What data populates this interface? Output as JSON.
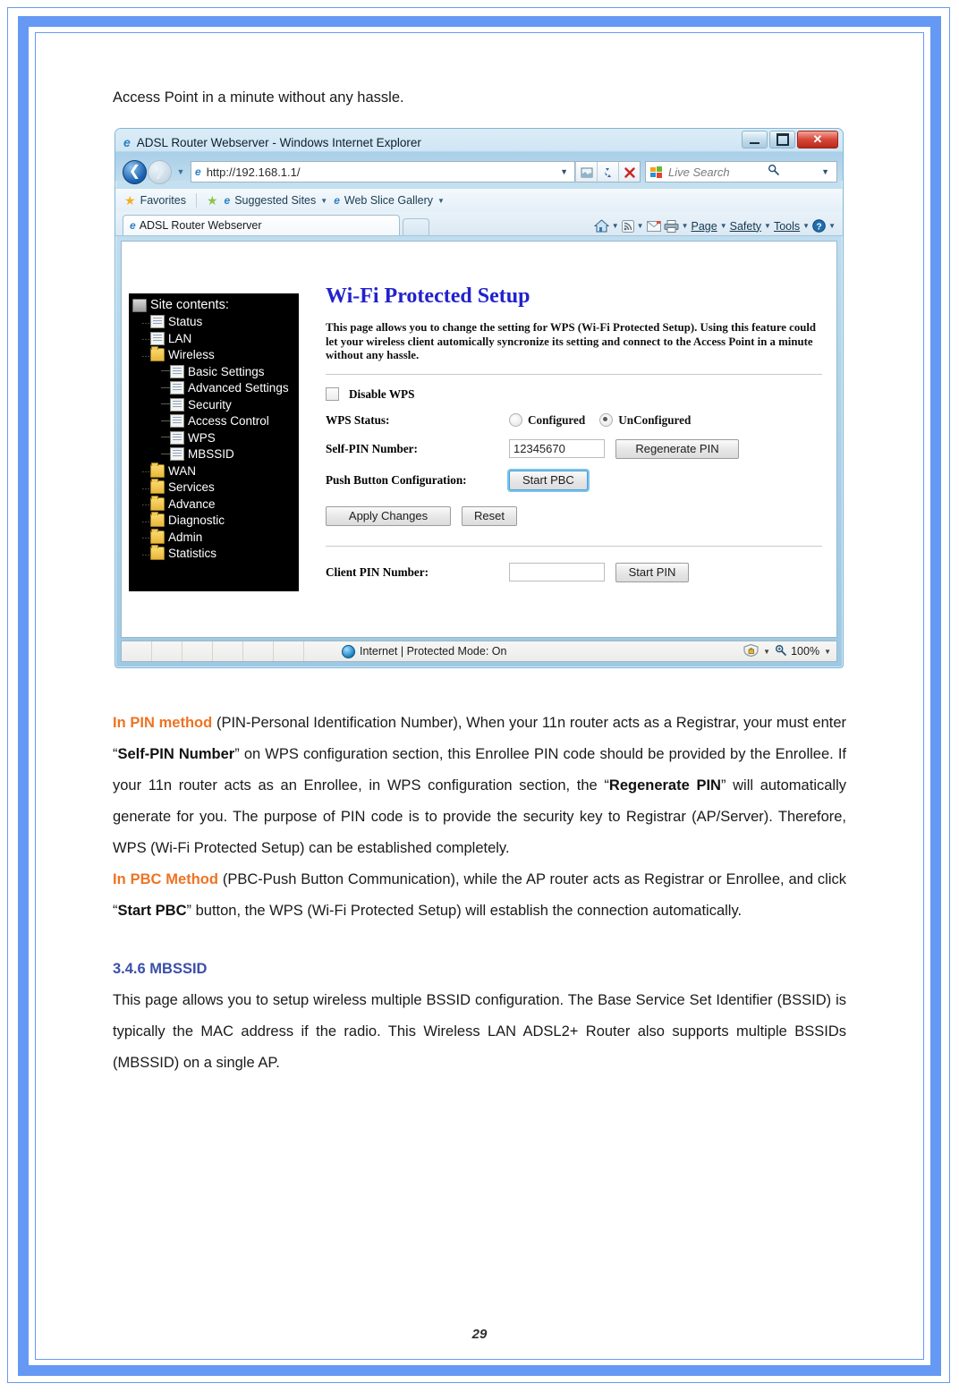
{
  "page": {
    "number": "29",
    "intro_line": "Access Point in a minute without any hassle.",
    "accent_orange": "#ee7322",
    "accent_blue": "#3b4fa8",
    "border_color": "#6699f3"
  },
  "paragraphs": {
    "pin_method": {
      "lead": "In PIN method",
      "t1": " (PIN-Personal Identification Number), When your 11n router acts as a Registrar, your must enter “",
      "b1": "Self-PIN Number",
      "t2": "” on WPS configuration section, this Enrollee PIN code should be provided by the Enrollee. If your 11n router acts as an Enrollee, in WPS configuration section, the “",
      "b2": "Regenerate PIN",
      "t3": "” will automatically generate for you. The purpose of PIN code is to provide the security key to Registrar (AP/Server). Therefore, WPS (Wi-Fi Protected Setup) can be established completely."
    },
    "pbc_method": {
      "lead": "In PBC Method",
      "t1": " (PBC-Push Button Communication), while the AP router acts as Registrar or Enrollee, and click “",
      "b1": "Start PBC",
      "t2": "” button, the WPS (Wi-Fi Protected Setup) will establish the connection automatically."
    },
    "mbssid_heading": "3.4.6 MBSSID",
    "mbssid_body": "This page allows you to setup wireless multiple BSSID configuration. The Base Service Set Identifier (BSSID) is typically the MAC address if the radio. This Wireless LAN ADSL2+ Router also supports multiple BSSIDs (MBSSID) on a single AP."
  },
  "browser": {
    "title": "ADSL Router Webserver - Windows Internet Explorer",
    "address_url": "http://192.168.1.1/",
    "search_placeholder": "Live Search",
    "favorites_label": "Favorites",
    "suggested_sites_label": "Suggested Sites",
    "web_slice_label": "Web Slice Gallery",
    "tab_title": "ADSL Router Webserver",
    "command_bar": [
      {
        "label": "Page"
      },
      {
        "label": "Safety"
      },
      {
        "label": "Tools"
      }
    ],
    "window_buttons": {
      "minimize": "–",
      "maximize": "□",
      "close": "✕"
    },
    "status": {
      "zone": "Internet | Protected Mode: On",
      "zoom": "100%"
    }
  },
  "router": {
    "tree_title": "Site contents:",
    "tree": [
      {
        "label": "Status",
        "icon": "page-icon",
        "level": 1
      },
      {
        "label": "LAN",
        "icon": "page-icon",
        "level": 1
      },
      {
        "label": "Wireless",
        "icon": "folder-open-icon",
        "level": 1
      },
      {
        "label": "Basic Settings",
        "icon": "page-icon",
        "level": 2
      },
      {
        "label": "Advanced Settings",
        "icon": "page-icon",
        "level": 2
      },
      {
        "label": "Security",
        "icon": "page-icon",
        "level": 2
      },
      {
        "label": "Access Control",
        "icon": "page-icon",
        "level": 2
      },
      {
        "label": "WPS",
        "icon": "page-icon",
        "level": 2
      },
      {
        "label": "MBSSID",
        "icon": "page-icon",
        "level": 2
      },
      {
        "label": "WAN",
        "icon": "folder-icon",
        "level": 1
      },
      {
        "label": "Services",
        "icon": "folder-icon",
        "level": 1
      },
      {
        "label": "Advance",
        "icon": "folder-icon",
        "level": 1
      },
      {
        "label": "Diagnostic",
        "icon": "folder-icon",
        "level": 1
      },
      {
        "label": "Admin",
        "icon": "folder-icon",
        "level": 1
      },
      {
        "label": "Statistics",
        "icon": "folder-icon",
        "level": 1
      }
    ],
    "heading": "Wi-Fi Protected Setup",
    "description": "This page allows you to change the setting for WPS (Wi-Fi Protected Setup). Using this feature could let your wireless client automically syncronize its setting and connect to the Access Point in a minute without any hassle.",
    "disable_wps_label": "Disable WPS",
    "disable_wps_checked": false,
    "wps_status_label": "WPS Status:",
    "wps_status_options": [
      {
        "label": "Configured",
        "selected": false
      },
      {
        "label": "UnConfigured",
        "selected": true
      }
    ],
    "self_pin_label": "Self-PIN Number:",
    "self_pin_value": "12345670",
    "regenerate_pin_label": "Regenerate PIN",
    "pbc_label": "Push Button Configuration:",
    "start_pbc_label": "Start PBC",
    "apply_label": "Apply Changes",
    "reset_label": "Reset",
    "client_pin_label": "Client PIN Number:",
    "client_pin_value": "",
    "start_pin_label": "Start PIN"
  }
}
